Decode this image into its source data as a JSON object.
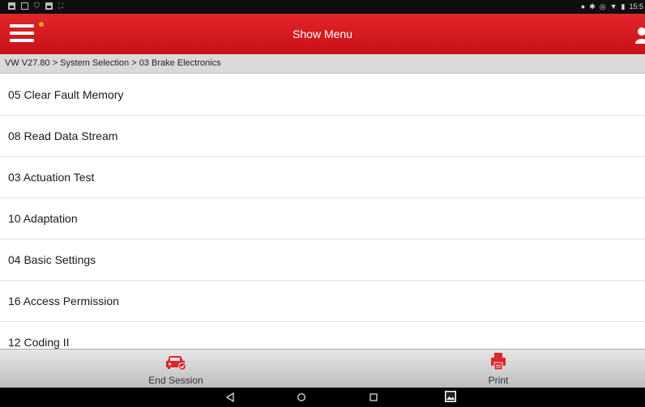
{
  "status_bar": {
    "time": "15:5",
    "left_icons": [
      "notification-icon",
      "message-icon",
      "download-icon",
      "notification-icon",
      "fullscreen-icon"
    ],
    "right_icons": [
      "location-icon",
      "bluetooth-icon",
      "alarm-icon",
      "wifi-icon",
      "battery-icon"
    ]
  },
  "app_bar": {
    "title": "Show Menu",
    "color": "#d21a20",
    "badge_color": "#f7a21b"
  },
  "breadcrumb": {
    "text": "VW V27.80 > System Selection > 03 Brake Electronics"
  },
  "menu": {
    "items": [
      {
        "label": "05 Clear Fault Memory"
      },
      {
        "label": "08 Read Data Stream"
      },
      {
        "label": "03 Actuation Test"
      },
      {
        "label": "10 Adaptation"
      },
      {
        "label": "04 Basic Settings"
      },
      {
        "label": "16 Access Permission"
      },
      {
        "label": "12 Coding II"
      }
    ]
  },
  "toolbar": {
    "end_session_label": "End Session",
    "print_label": "Print",
    "icon_color": "#e1252b"
  },
  "nav_bar": {
    "buttons": [
      "back-icon",
      "home-icon",
      "recents-icon",
      "screenshot-icon"
    ]
  }
}
